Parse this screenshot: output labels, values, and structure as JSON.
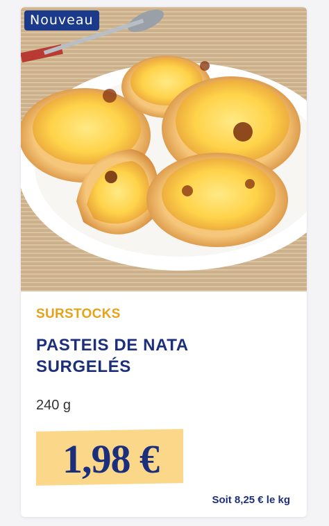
{
  "badge": {
    "label": "Nouveau"
  },
  "product": {
    "image_icon": "pasteis-de-nata-photo",
    "category": "SURSTOCKS",
    "title_line1": "PASTEIS DE NATA",
    "title_line2": "SURGELÉS",
    "weight": "240 g",
    "price": "1,98 €",
    "unit_price": "Soit 8,25 € le kg"
  },
  "colors": {
    "badge_bg": "#1b3a8c",
    "category": "#e8a21a",
    "title": "#1c2f7c",
    "price_bg": "#fbd78a"
  }
}
